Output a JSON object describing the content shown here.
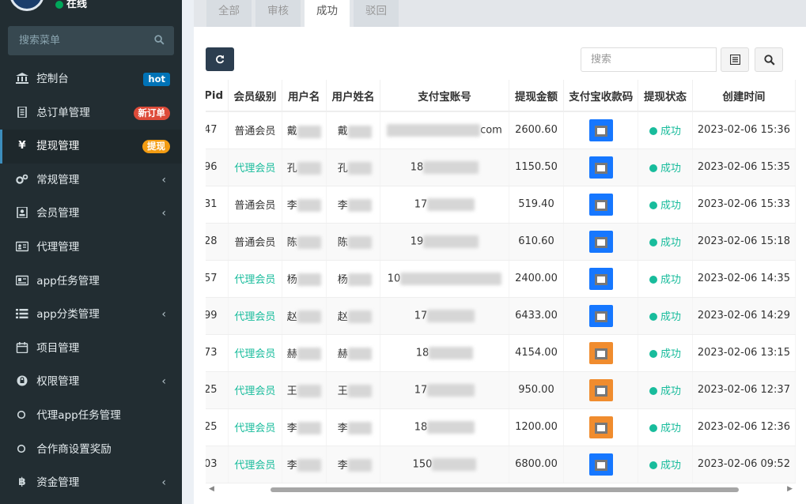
{
  "sidebar": {
    "status": "在线",
    "search_placeholder": "搜索菜单",
    "items": [
      {
        "label": "控制台",
        "badge": "hot"
      },
      {
        "label": "总订单管理",
        "badge": "新订单"
      },
      {
        "label": "提现管理",
        "badge": "提现"
      },
      {
        "label": "常规管理"
      },
      {
        "label": "会员管理"
      },
      {
        "label": "代理管理"
      },
      {
        "label": "app任务管理"
      },
      {
        "label": "app分类管理"
      },
      {
        "label": "项目管理"
      },
      {
        "label": "权限管理"
      },
      {
        "label": "代理app任务管理"
      },
      {
        "label": "合作商设置奖励"
      },
      {
        "label": "资金管理"
      }
    ]
  },
  "tabs": [
    "全部",
    "审核",
    "成功",
    "驳回"
  ],
  "toolbar": {
    "search_placeholder": "搜索"
  },
  "table": {
    "headers": [
      "Pid",
      "会员级别",
      "用户名",
      "用户姓名",
      "支付宝账号",
      "提现金额",
      "支付宝收款码",
      "提现状态",
      "创建时间"
    ],
    "rows": [
      {
        "pid": "47",
        "level": "普通会员",
        "user": "戴",
        "name": "戴",
        "account": "com",
        "amount": "2600.60",
        "qr": "blue",
        "status": "成功",
        "time": "2023-02-06 15:36"
      },
      {
        "pid": "96",
        "level": "代理会员",
        "user": "孔",
        "name": "孔",
        "account": "18",
        "amount": "1150.50",
        "qr": "blue",
        "status": "成功",
        "time": "2023-02-06 15:35"
      },
      {
        "pid": "31",
        "level": "普通会员",
        "user": "李",
        "name": "李",
        "account": "17",
        "amount": "519.40",
        "qr": "blue",
        "status": "成功",
        "time": "2023-02-06 15:33"
      },
      {
        "pid": "28",
        "level": "普通会员",
        "user": "陈",
        "name": "陈",
        "account": "19",
        "amount": "610.60",
        "qr": "blue",
        "status": "成功",
        "time": "2023-02-06 15:18"
      },
      {
        "pid": "57",
        "level": "代理会员",
        "user": "杨",
        "name": "杨",
        "account": "10",
        "amount": "2400.00",
        "qr": "blue",
        "status": "成功",
        "time": "2023-02-06 14:35"
      },
      {
        "pid": "99",
        "level": "代理会员",
        "user": "赵",
        "name": "赵",
        "account": "17",
        "amount": "6433.00",
        "qr": "blue",
        "status": "成功",
        "time": "2023-02-06 14:29"
      },
      {
        "pid": "73",
        "level": "代理会员",
        "user": "赫",
        "name": "赫",
        "account": "18",
        "amount": "4154.00",
        "qr": "orange",
        "status": "成功",
        "time": "2023-02-06 13:15"
      },
      {
        "pid": "25",
        "level": "代理会员",
        "user": "王",
        "name": "王",
        "account": "17",
        "amount": "950.00",
        "qr": "orange",
        "status": "成功",
        "time": "2023-02-06 12:37"
      },
      {
        "pid": "25",
        "level": "代理会员",
        "user": "李",
        "name": "李",
        "account": "18",
        "amount": "1200.00",
        "qr": "orange",
        "status": "成功",
        "time": "2023-02-06 12:36"
      },
      {
        "pid": "03",
        "level": "代理会员",
        "user": "李",
        "name": "李",
        "account": "150",
        "amount": "6800.00",
        "qr": "blue",
        "status": "成功",
        "time": "2023-02-06 09:52"
      }
    ]
  },
  "colors": {
    "sidebar_bg": "#222d32",
    "accent": "#18bc9c",
    "primary": "#3c8dbc"
  }
}
